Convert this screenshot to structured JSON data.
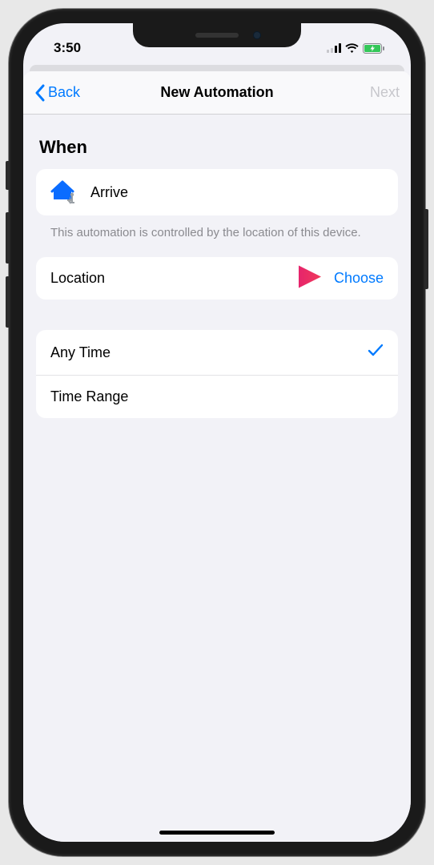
{
  "status": {
    "time": "3:50"
  },
  "nav": {
    "back": "Back",
    "title": "New Automation",
    "next": "Next"
  },
  "section_header": "When",
  "trigger": {
    "label": "Arrive",
    "footer": "This automation is controlled by the location of this device."
  },
  "location": {
    "label": "Location",
    "action": "Choose"
  },
  "time_options": [
    {
      "label": "Any Time",
      "selected": true
    },
    {
      "label": "Time Range",
      "selected": false
    }
  ],
  "colors": {
    "accent": "#007aff",
    "disabled": "#c7c7cc",
    "annotation": "#e6246c"
  }
}
